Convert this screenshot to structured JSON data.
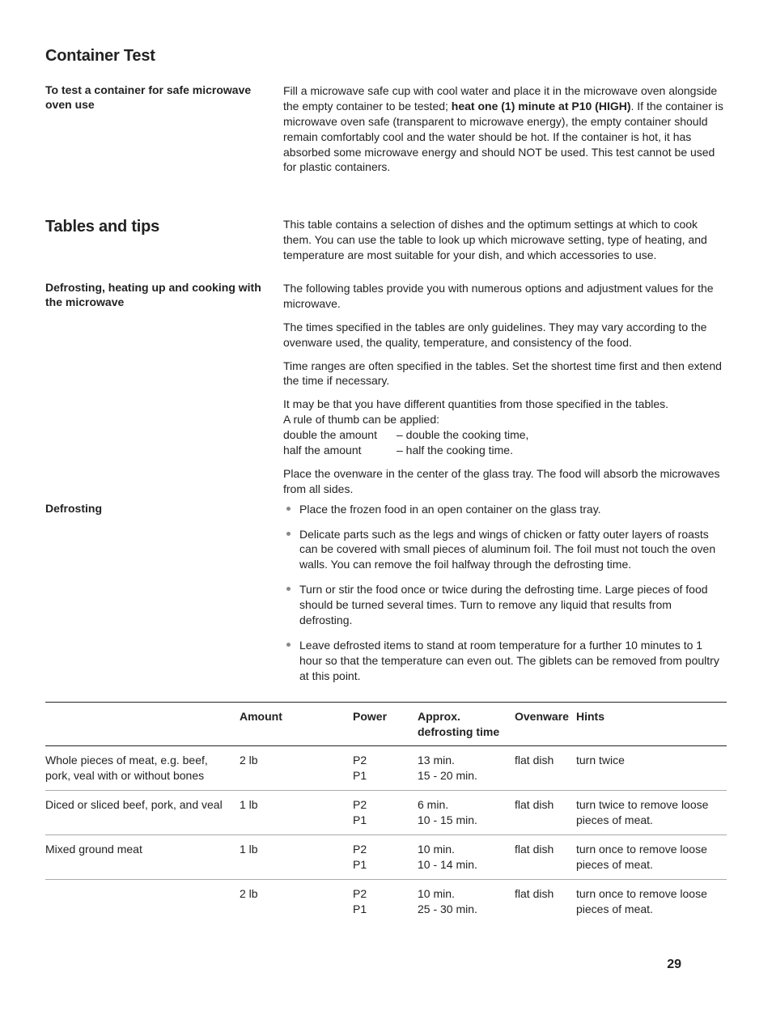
{
  "section1": {
    "title": "Container Test",
    "left": "To test a container for safe microwave oven use",
    "para_a": "Fill a microwave safe cup with cool water and place it in the microwave oven alongside the empty container to be tested; ",
    "para_bold": "heat one (1) minute at P10 (HIGH)",
    "para_b": ". If the container is microwave oven safe (transparent to microwave energy), the empty container should remain comfortably cool and the water should be hot. If the container is hot, it has absorbed some microwave energy and should NOT be used. This test cannot be used for plastic containers."
  },
  "section2": {
    "title": "Tables and tips",
    "intro": "This table contains a selection of dishes and the optimum settings at which to cook them. You can use the table to look up which microwave setting, type of heating, and temperature are most suitable for your dish, and which accessories to use."
  },
  "section3": {
    "left": "Defrosting, heating up and cooking with the microwave",
    "p1": "The following tables provide you with numerous options and adjustment values for the microwave.",
    "p2": "The times specified in the tables are only guidelines. They may vary according to the ovenware used, the quality, temperature, and consistency of the food.",
    "p3": "Time ranges are often specified in the tables. Set the shortest time first and then extend the time if necessary.",
    "p4a": "It may be that you have different quantities from those specified in the tables.",
    "p4b": "A rule of thumb can be applied:",
    "rule1_left": "double the amount",
    "rule1_right": "– double the cooking time,",
    "rule2_left": "half the amount",
    "rule2_right": "– half the cooking time.",
    "p5": "Place the ovenware in the center of the glass tray. The food will absorb the microwaves from all sides."
  },
  "section4": {
    "left": "Defrosting",
    "bullets": [
      "Place the frozen food in an open container on the glass tray.",
      "Delicate parts such as the legs and wings of chicken or fatty outer layers of roasts can be covered with small pieces of aluminum foil. The foil must not touch the oven walls. You can remove the foil halfway through the defrosting time.",
      "Turn or stir the food once or twice during the defrosting time. Large pieces of food should be turned several times. Turn to remove any liquid that results from defrosting.",
      "Leave defrosted items to stand at room temperature for a further 10 minutes to 1 hour so that the temperature can even out. The giblets can be removed from poultry at this point."
    ]
  },
  "table": {
    "headers": {
      "item": "",
      "amount": "Amount",
      "power": "Power",
      "time": "Approx. defrosting time",
      "oven": "Ovenware",
      "hints": "Hints"
    },
    "rows": [
      {
        "item": "Whole pieces of meat, e.g. beef, pork, veal with or without bones",
        "amount": "2 lb",
        "power": "P2\nP1",
        "time": "13 min.\n15 - 20 min.",
        "oven": "flat dish",
        "hints": "turn twice"
      },
      {
        "item": "Diced or sliced beef, pork, and veal",
        "amount": "1 lb",
        "power": "P2\nP1",
        "time": "6 min.\n10 - 15 min.",
        "oven": "flat dish",
        "hints": "turn twice to remove loose pieces of meat."
      },
      {
        "item": "Mixed ground meat",
        "amount": "1 lb",
        "power": "P2\nP1",
        "time": "10 min.\n10 - 14 min.",
        "oven": "flat dish",
        "hints": "turn once to remove loose pieces of meat."
      },
      {
        "item": "",
        "amount": "2 lb",
        "power": "P2\nP1",
        "time": "10 min.\n25 - 30 min.",
        "oven": "flat dish",
        "hints": "turn once to remove loose pieces of meat."
      }
    ]
  },
  "page_number": "29"
}
